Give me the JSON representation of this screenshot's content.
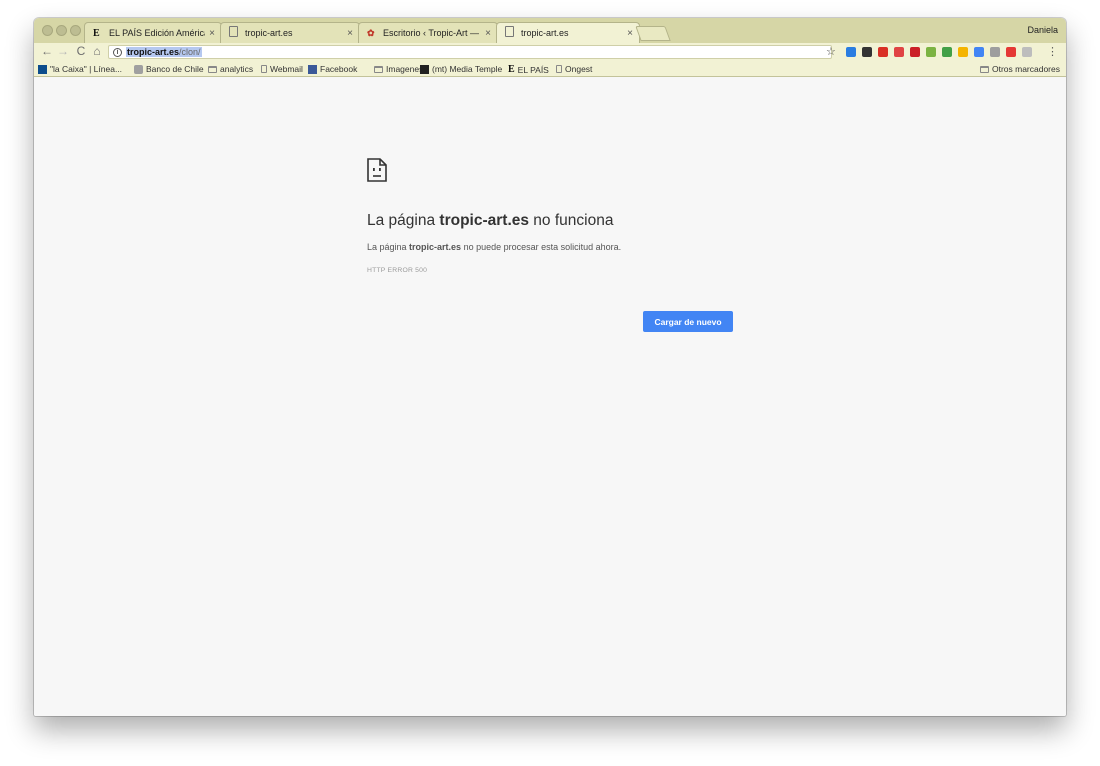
{
  "window": {
    "profile_name": "Daniela"
  },
  "tabs": [
    {
      "favicon": "E",
      "favicon_name": "el-pais-icon",
      "title": "EL PAÍS Edición América: el p",
      "close": "×"
    },
    {
      "favicon": "",
      "favicon_name": "page-icon",
      "title": "tropic-art.es",
      "close": "×"
    },
    {
      "favicon": "✿",
      "favicon_name": "wordpress-icon",
      "title": "Escritorio ‹ Tropic-Art — Word",
      "close": "×"
    },
    {
      "favicon": "",
      "favicon_name": "page-icon",
      "title": "tropic-art.es",
      "close": "×"
    }
  ],
  "toolbar": {
    "back": "←",
    "forward": "→",
    "reload": "C",
    "home": "⌂",
    "info": "i",
    "star": "☆",
    "menu": "⋮"
  },
  "omnibox": {
    "host": "tropic-art.es",
    "path": "/clon/"
  },
  "extensions": [
    {
      "name": "opera-icon",
      "color": "#2a7de1"
    },
    {
      "name": "buffer-icon",
      "color": "#333333"
    },
    {
      "name": "bookmark-star-icon",
      "color": "#d93025"
    },
    {
      "name": "adblock-icon",
      "color": "#e04343"
    },
    {
      "name": "pinterest-icon",
      "color": "#cb2027"
    },
    {
      "name": "puzzle-icon",
      "color": "#7cb342"
    },
    {
      "name": "diamond-icon",
      "color": "#43a047"
    },
    {
      "name": "chart-icon",
      "color": "#f4b400"
    },
    {
      "name": "checkmark-icon",
      "color": "#4285f4"
    },
    {
      "name": "shield-icon",
      "color": "#9e9e9e"
    },
    {
      "name": "pin-icon",
      "color": "#e53935"
    },
    {
      "name": "grid-icon",
      "color": "#bdbdbd"
    }
  ],
  "bookmarks": [
    {
      "icon": "lc",
      "icon_name": "la-caixa-icon",
      "label": "\"la Caixa\" | Línea..."
    },
    {
      "icon": "bch",
      "icon_name": "banco-chile-icon",
      "label": "Banco de Chile"
    },
    {
      "icon": "folder",
      "icon_name": "folder-icon",
      "label": "analytics"
    },
    {
      "icon": "page",
      "icon_name": "page-icon",
      "label": "Webmail"
    },
    {
      "icon": "fb",
      "icon_name": "facebook-icon",
      "label": "Facebook"
    },
    {
      "icon": "folder",
      "icon_name": "folder-icon",
      "label": "Imagenes"
    },
    {
      "icon": "mt",
      "icon_name": "media-temple-icon",
      "label": "(mt) Media Temple"
    },
    {
      "icon": "ep",
      "icon_name": "el-pais-icon",
      "label": "EL PAÍS"
    },
    {
      "icon": "page",
      "icon_name": "page-icon",
      "label": "Ongest"
    }
  ],
  "other_bookmarks": "Otros marcadores",
  "error": {
    "title_prefix": "La página ",
    "title_host": "tropic-art.es",
    "title_suffix": " no funciona",
    "desc_prefix": "La página ",
    "desc_host": "tropic-art.es",
    "desc_suffix": " no puede procesar esta solicitud ahora.",
    "code": "HTTP ERROR 500",
    "reload_label": "Cargar de nuevo"
  }
}
